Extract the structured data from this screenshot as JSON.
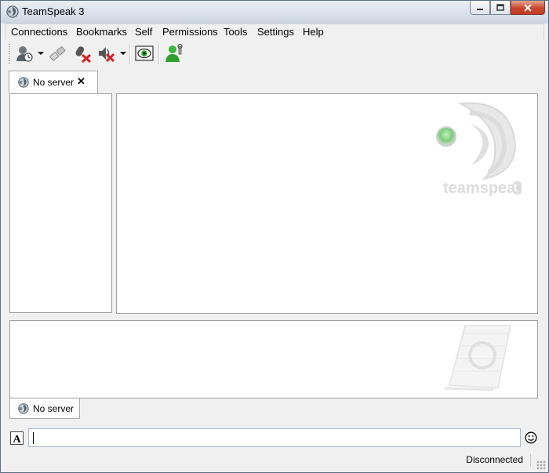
{
  "window": {
    "title": "TeamSpeak 3"
  },
  "menu": [
    "Connections",
    "Bookmarks",
    "Self",
    "Permissions",
    "Tools",
    "Settings",
    "Help"
  ],
  "toolbar": {
    "buttons": [
      "connect-icon",
      "disconnect-icon",
      "mute-microphone-icon",
      "mute-speakers-icon",
      "away-icon",
      "identity-icon"
    ]
  },
  "server_tab": {
    "label": "No server",
    "close": "✕"
  },
  "chat_tab": {
    "label": "No server"
  },
  "watermark": {
    "brand": "teamspeak",
    "version": "3"
  },
  "chat_input": {
    "value": ""
  },
  "status_bar": {
    "status": "Disconnected"
  },
  "colors": {
    "accent": "#3fa7d6",
    "green": "#28a428"
  }
}
